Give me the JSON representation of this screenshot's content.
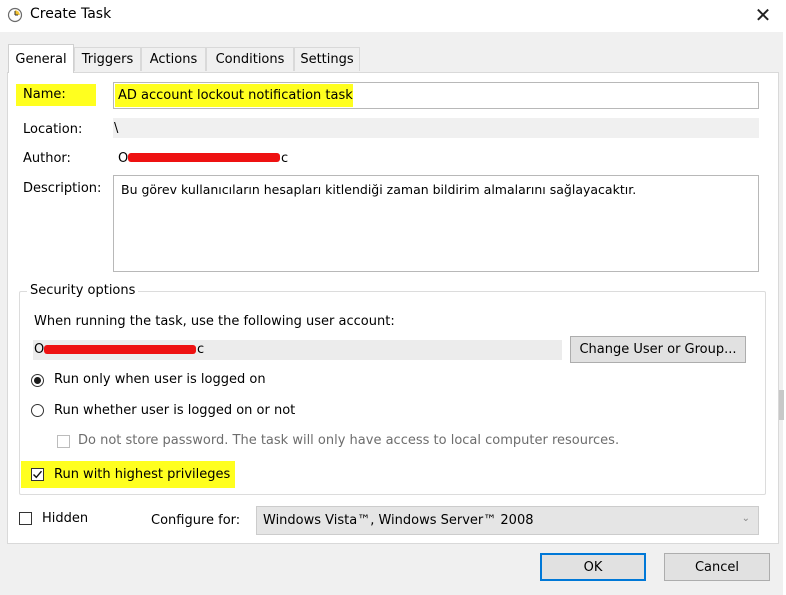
{
  "window": {
    "title": "Create Task",
    "icon": "task-scheduler-clock-icon",
    "close_icon": "close-icon"
  },
  "tabs": [
    {
      "label": "General"
    },
    {
      "label": "Triggers"
    },
    {
      "label": "Actions"
    },
    {
      "label": "Conditions"
    },
    {
      "label": "Settings"
    }
  ],
  "general": {
    "name_label": "Name:",
    "name_value": "AD account lockout notification task",
    "location_label": "Location:",
    "location_value": "\\",
    "author_label": "Author:",
    "author_visible_start": "O",
    "author_visible_end": "c",
    "description_label": "Description:",
    "description_value": "Bu görev kullanıcıların hesapları kitlendiği zaman bildirim almalarını sağlayacaktır.",
    "highlight_color": "#ffff1f",
    "redaction_color": "#ee1111"
  },
  "security": {
    "group_label": "Security options",
    "account_prompt": "When running the task, use the following user account:",
    "account_visible_start": "O",
    "account_visible_end": "c",
    "change_button": "Change User or Group...",
    "radio_logged_on": "Run only when user is logged on",
    "radio_logged_on_selected": true,
    "radio_whether": "Run whether user is logged on or not",
    "radio_whether_selected": false,
    "no_store_password": "Do not store password.  The task will only have access to local computer resources.",
    "no_store_password_checked": false,
    "highest_privileges": "Run with highest privileges",
    "highest_privileges_checked": true
  },
  "bottom": {
    "hidden_label": "Hidden",
    "hidden_checked": false,
    "configure_label": "Configure for:",
    "configure_value": "Windows Vista™, Windows Server™ 2008"
  },
  "buttons": {
    "ok": "OK",
    "cancel": "Cancel"
  }
}
